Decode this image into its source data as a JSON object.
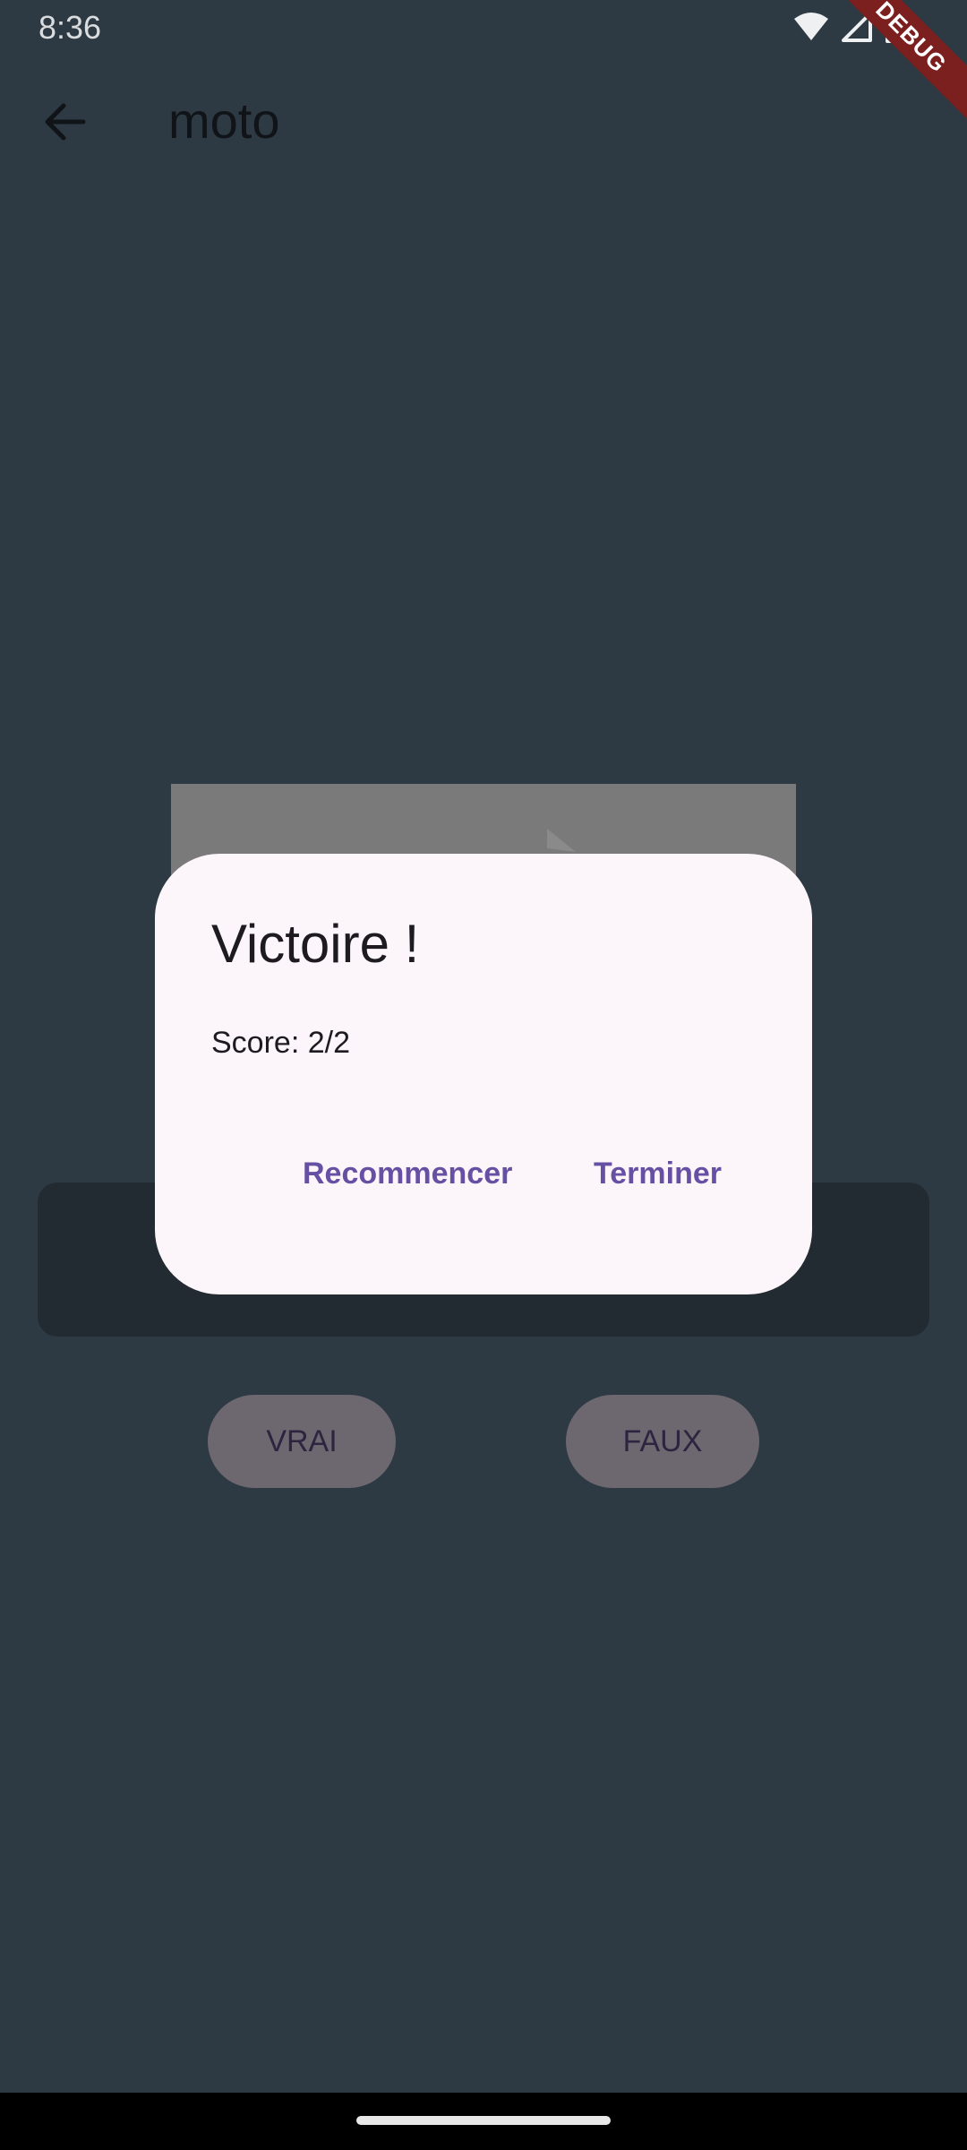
{
  "status_bar": {
    "time": "8:36",
    "icons": [
      "wifi-icon",
      "signal-icon",
      "battery-icon"
    ],
    "debug_banner": "DEBUG"
  },
  "app_bar": {
    "back_icon": "arrow-back-icon",
    "title": "moto"
  },
  "quiz": {
    "answer_true": "VRAI",
    "answer_false": "FAUX"
  },
  "dialog": {
    "title": "Victoire !",
    "content": "Score: 2/2",
    "actions": {
      "restart": "Recommencer",
      "finish": "Terminer"
    }
  },
  "colors": {
    "background": "#2e3a43",
    "dialog_surface": "#fcf5fa",
    "accent": "#6650a4",
    "debug_banner": "#7b1f1f"
  }
}
